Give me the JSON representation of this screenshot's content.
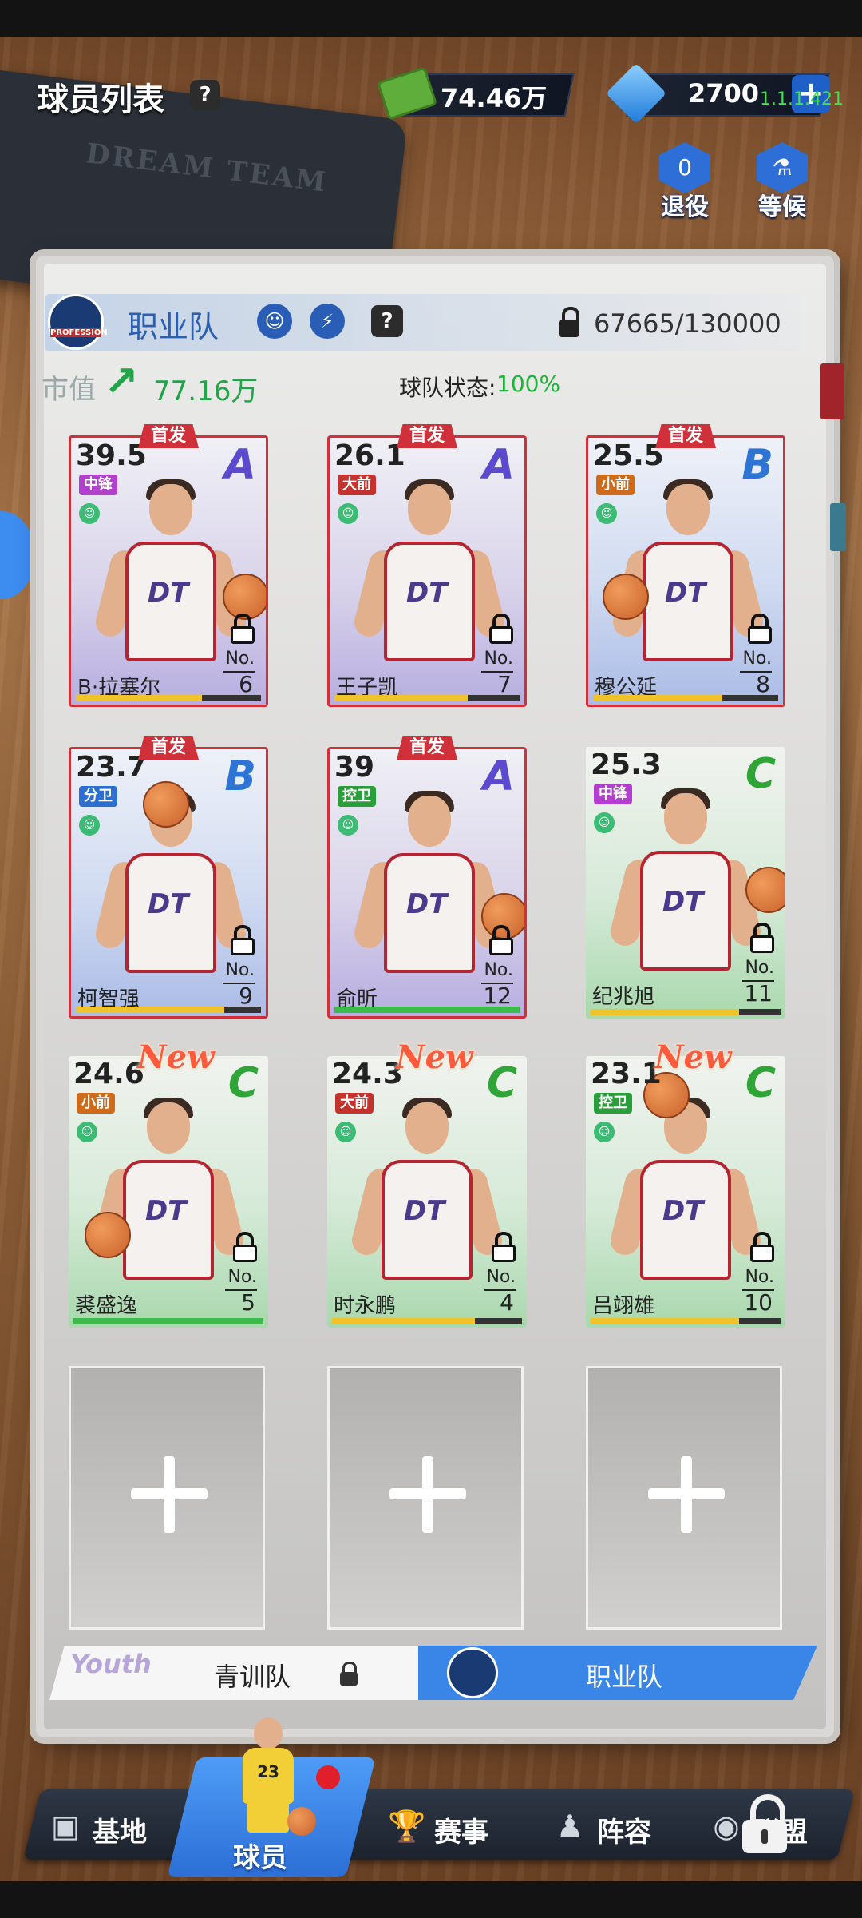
{
  "header": {
    "title": "球员列表",
    "help": "?",
    "money": "74.46万",
    "gems": "2700",
    "plus": "+",
    "version": "1.1.1.421"
  },
  "notebook": {
    "cover_text": "DREAM TEAM"
  },
  "side_buttons": {
    "retire": {
      "label": "退役",
      "count": "0"
    },
    "waitlist": {
      "label": "等候"
    }
  },
  "team": {
    "logo_text": "PROFESSION",
    "name": "职业队",
    "help": "?",
    "capacity": "67665/130000",
    "market_value_label": "市值",
    "market_value": "77.16万",
    "status_label": "球队状态:",
    "status_value": "100%"
  },
  "labels": {
    "starter": "首发",
    "new": "New",
    "no": "No."
  },
  "players": [
    {
      "ovr": "39.5",
      "grade": "A",
      "pos": "中锋",
      "pos_color": "#b23fce",
      "name": "B·拉塞尔",
      "number": "6",
      "starter": true,
      "new": false,
      "fill": 0.68,
      "fill_color": "#f0c32a"
    },
    {
      "ovr": "26.1",
      "grade": "A",
      "pos": "大前",
      "pos_color": "#c4332d",
      "name": "王子凯",
      "number": "7",
      "starter": true,
      "new": false,
      "fill": 0.72,
      "fill_color": "#f0c32a"
    },
    {
      "ovr": "25.5",
      "grade": "B",
      "pos": "小前",
      "pos_color": "#d06a1b",
      "name": "穆公延",
      "number": "8",
      "starter": true,
      "new": false,
      "fill": 0.7,
      "fill_color": "#f0c32a"
    },
    {
      "ovr": "23.7",
      "grade": "B",
      "pos": "分卫",
      "pos_color": "#2a6fd1",
      "name": "柯智强",
      "number": "9",
      "starter": true,
      "new": false,
      "fill": 0.8,
      "fill_color": "#f0c32a"
    },
    {
      "ovr": "39",
      "grade": "A",
      "pos": "控卫",
      "pos_color": "#2a9e3a",
      "name": "俞昕",
      "number": "12",
      "starter": true,
      "new": false,
      "fill": 1.0,
      "fill_color": "#3cbb4a"
    },
    {
      "ovr": "25.3",
      "grade": "C",
      "pos": "中锋",
      "pos_color": "#b23fce",
      "name": "纪兆旭",
      "number": "11",
      "starter": false,
      "new": false,
      "fill": 0.78,
      "fill_color": "#f0c32a"
    },
    {
      "ovr": "24.6",
      "grade": "C",
      "pos": "小前",
      "pos_color": "#d06a1b",
      "name": "裘盛逸",
      "number": "5",
      "starter": false,
      "new": true,
      "fill": 1.0,
      "fill_color": "#3cbb4a"
    },
    {
      "ovr": "24.3",
      "grade": "C",
      "pos": "大前",
      "pos_color": "#c4332d",
      "name": "时永鹏",
      "number": "4",
      "starter": false,
      "new": true,
      "fill": 0.75,
      "fill_color": "#f0c32a"
    },
    {
      "ovr": "23.1",
      "grade": "C",
      "pos": "控卫",
      "pos_color": "#2a9e3a",
      "name": "吕翊雄",
      "number": "10",
      "starter": false,
      "new": true,
      "fill": 0.78,
      "fill_color": "#f0c32a"
    }
  ],
  "tabs": {
    "youth": {
      "label": "青训队",
      "logo": "Youth"
    },
    "pro": {
      "label": "职业队"
    }
  },
  "nav": {
    "base": "基地",
    "players": "球员",
    "events": "赛事",
    "lineup": "阵容",
    "league": "联盟",
    "player_number": "23"
  }
}
